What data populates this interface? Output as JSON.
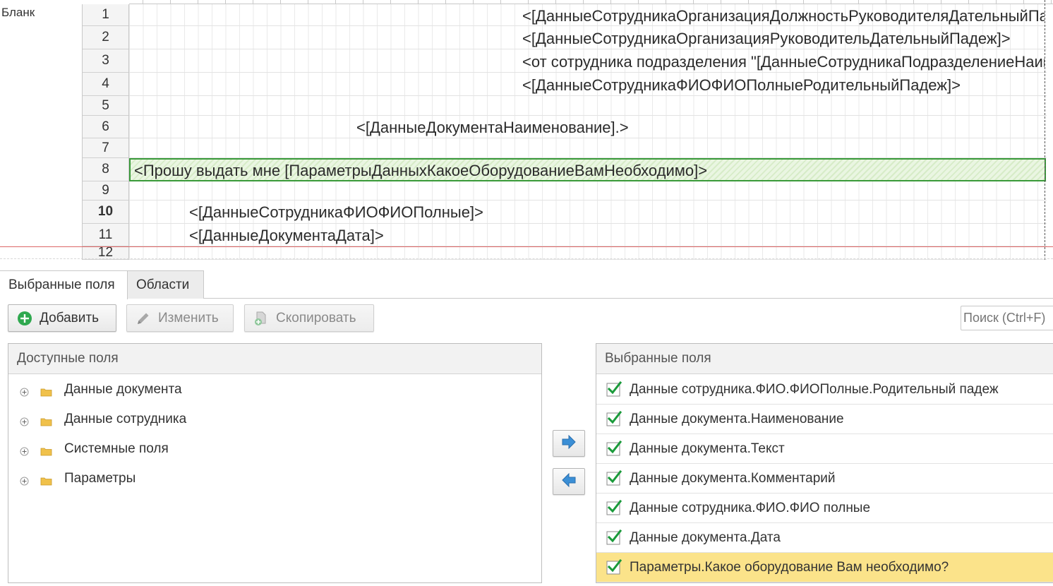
{
  "sheet": {
    "area_label": "Бланк",
    "row_numbers": [
      "1",
      "2",
      "3",
      "4",
      "5",
      "6",
      "7",
      "8",
      "9",
      "10",
      "11",
      "12"
    ],
    "cells": {
      "row1": "<[ДанныеСотрудникаОрганизацияДолжностьРуководителяДательныйПадеж]>",
      "row2": "<[ДанныеСотрудникаОрганизацияРуководительДательныйПадеж]>",
      "row3": "<от сотрудника подразделения \"[ДанныеСотрудникаПодразделениеНаименование]\">",
      "row4": "<[ДанныеСотрудникаФИОФИОПолныеРодительныйПадеж]>",
      "row6": "<[ДанныеДокументаНаименование].>",
      "row8": "<Прошу выдать мне  [ПараметрыДанныхКакоеОборудованиеВамНеобходимо]>",
      "row10": "<[ДанныеСотрудникаФИОФИОПолные]>",
      "row11": "<[ДанныеДокументаДата]>"
    },
    "selected_row_number": "8",
    "bold_row_number": "10"
  },
  "tabs": {
    "selected_fields": "Выбранные поля",
    "areas": "Области",
    "active": "selected_fields"
  },
  "toolbar": {
    "add_label": "Добавить",
    "edit_label": "Изменить",
    "copy_label": "Скопировать",
    "search_placeholder": "Поиск (Ctrl+F)"
  },
  "available_fields": {
    "header": "Доступные поля",
    "items": [
      {
        "label": "Данные документа",
        "icon": "folder-icon"
      },
      {
        "label": "Данные сотрудника",
        "icon": "folder-icon"
      },
      {
        "label": "Системные поля",
        "icon": "folder-icon"
      },
      {
        "label": "Параметры",
        "icon": "folder-icon"
      }
    ]
  },
  "selected_fields": {
    "header": "Выбранные поля",
    "items": [
      {
        "label": "Данные сотрудника.ФИО.ФИОПолные.Родительный падеж",
        "checked": true
      },
      {
        "label": "Данные документа.Наименование",
        "checked": true
      },
      {
        "label": "Данные документа.Текст",
        "checked": true
      },
      {
        "label": "Данные документа.Комментарий",
        "checked": true
      },
      {
        "label": "Данные сотрудника.ФИО.ФИО полные",
        "checked": true
      },
      {
        "label": "Данные документа.Дата",
        "checked": true
      },
      {
        "label": "Параметры.Какое оборудование Вам необходимо?",
        "checked": true,
        "highlighted": true
      }
    ]
  },
  "colors": {
    "selection_green": "#3a9a3a",
    "highlight_yellow": "#fbe38a",
    "check_green": "#1a9a3a",
    "arrow_blue": "#3b8fd6",
    "folder_yellow": "#f0c14b"
  }
}
